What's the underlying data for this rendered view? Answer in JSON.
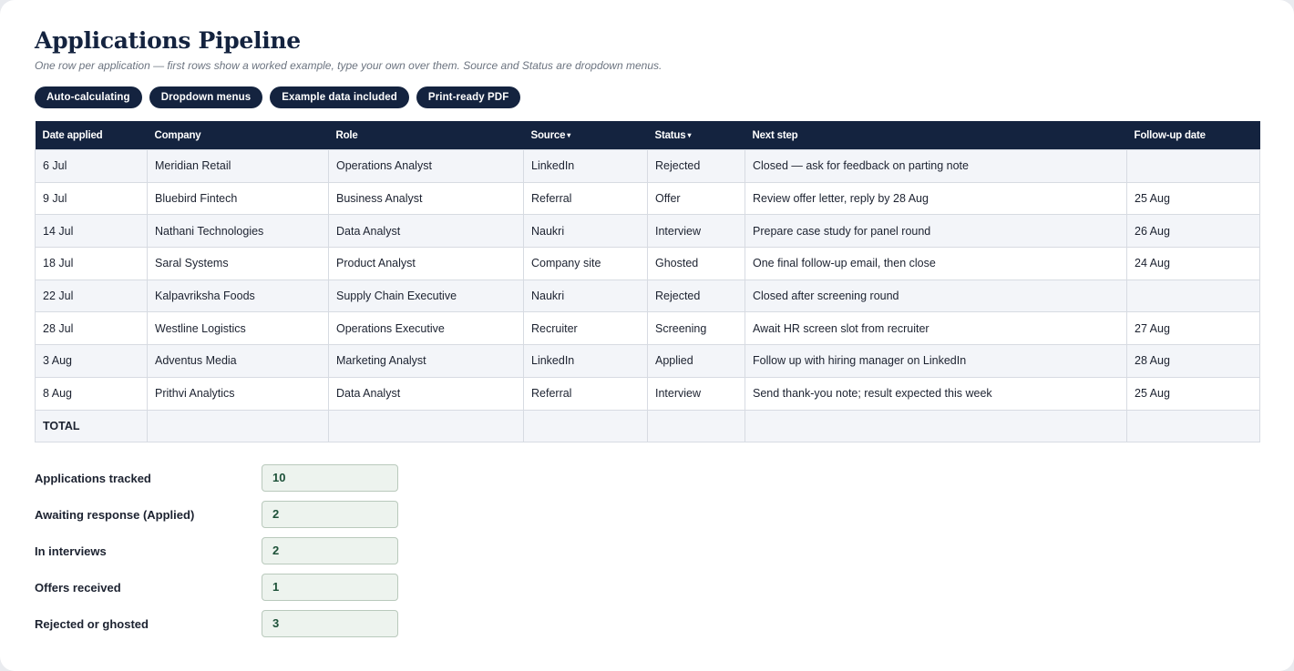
{
  "header": {
    "title": "Applications Pipeline",
    "subtitle": "One row per application — first rows show a worked example, type your own over them. Source and Status are dropdown menus."
  },
  "chips": [
    "Auto-calculating",
    "Dropdown menus",
    "Example data included",
    "Print-ready PDF"
  ],
  "table": {
    "columns": [
      {
        "label": "Date applied",
        "dropdown": false
      },
      {
        "label": "Company",
        "dropdown": false
      },
      {
        "label": "Role",
        "dropdown": false
      },
      {
        "label": "Source",
        "dropdown": true
      },
      {
        "label": "Status",
        "dropdown": true
      },
      {
        "label": "Next step",
        "dropdown": false
      },
      {
        "label": "Follow-up date",
        "dropdown": false
      }
    ],
    "caret": "▾",
    "rows": [
      [
        "6 Jul",
        "Meridian Retail",
        "Operations Analyst",
        "LinkedIn",
        "Rejected",
        "Closed — ask for feedback on parting note",
        ""
      ],
      [
        "9 Jul",
        "Bluebird Fintech",
        "Business Analyst",
        "Referral",
        "Offer",
        "Review offer letter, reply by 28 Aug",
        "25 Aug"
      ],
      [
        "14 Jul",
        "Nathani Technologies",
        "Data Analyst",
        "Naukri",
        "Interview",
        "Prepare case study for panel round",
        "26 Aug"
      ],
      [
        "18 Jul",
        "Saral Systems",
        "Product Analyst",
        "Company site",
        "Ghosted",
        "One final follow-up email, then close",
        "24 Aug"
      ],
      [
        "22 Jul",
        "Kalpavriksha Foods",
        "Supply Chain Executive",
        "Naukri",
        "Rejected",
        "Closed after screening round",
        ""
      ],
      [
        "28 Jul",
        "Westline Logistics",
        "Operations Executive",
        "Recruiter",
        "Screening",
        "Await HR screen slot from recruiter",
        "27 Aug"
      ],
      [
        "3 Aug",
        "Adventus Media",
        "Marketing Analyst",
        "LinkedIn",
        "Applied",
        "Follow up with hiring manager on LinkedIn",
        "28 Aug"
      ],
      [
        "8 Aug",
        "Prithvi Analytics",
        "Data Analyst",
        "Referral",
        "Interview",
        "Send thank-you note; result expected this week",
        "25 Aug"
      ]
    ],
    "total_label": "TOTAL"
  },
  "summary": [
    {
      "label": "Applications tracked",
      "value": "10"
    },
    {
      "label": "Awaiting response (Applied)",
      "value": "2"
    },
    {
      "label": "In interviews",
      "value": "2"
    },
    {
      "label": "Offers received",
      "value": "1"
    },
    {
      "label": "Rejected or ghosted",
      "value": "3"
    }
  ],
  "colors": {
    "navy": "#14233f",
    "summary_value_bg": "#edf3ee",
    "summary_value_text": "#1d5138"
  }
}
